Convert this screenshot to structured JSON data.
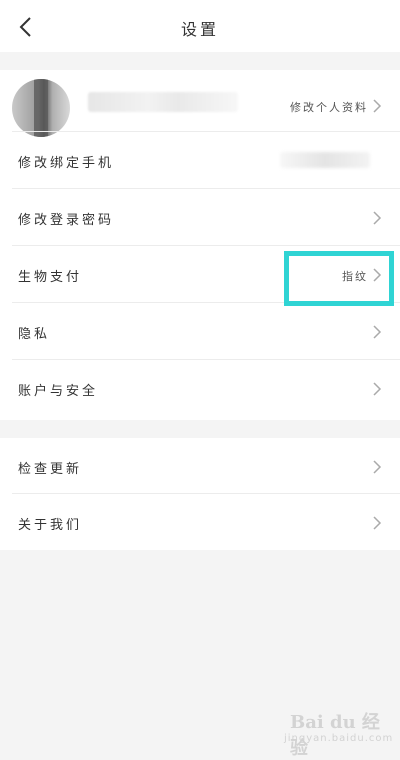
{
  "header": {
    "title": "设置",
    "back_icon": "chevron-left-icon"
  },
  "profile": {
    "edit_label": "修改个人资料"
  },
  "group1": {
    "items": [
      {
        "label": "修改绑定手机",
        "value": ""
      },
      {
        "label": "修改登录密码",
        "value": ""
      },
      {
        "label": "生物支付",
        "value": "指纹"
      },
      {
        "label": "隐私",
        "value": ""
      },
      {
        "label": "账户与安全",
        "value": ""
      }
    ]
  },
  "group2": {
    "items": [
      {
        "label": "检查更新"
      },
      {
        "label": "关于我们"
      }
    ]
  },
  "watermark": {
    "brand": "Bai du 经验",
    "url": "jingyan.baidu.com"
  },
  "colors": {
    "highlight": "#2fd4d4",
    "background": "#f4f4f4",
    "card": "#ffffff"
  }
}
